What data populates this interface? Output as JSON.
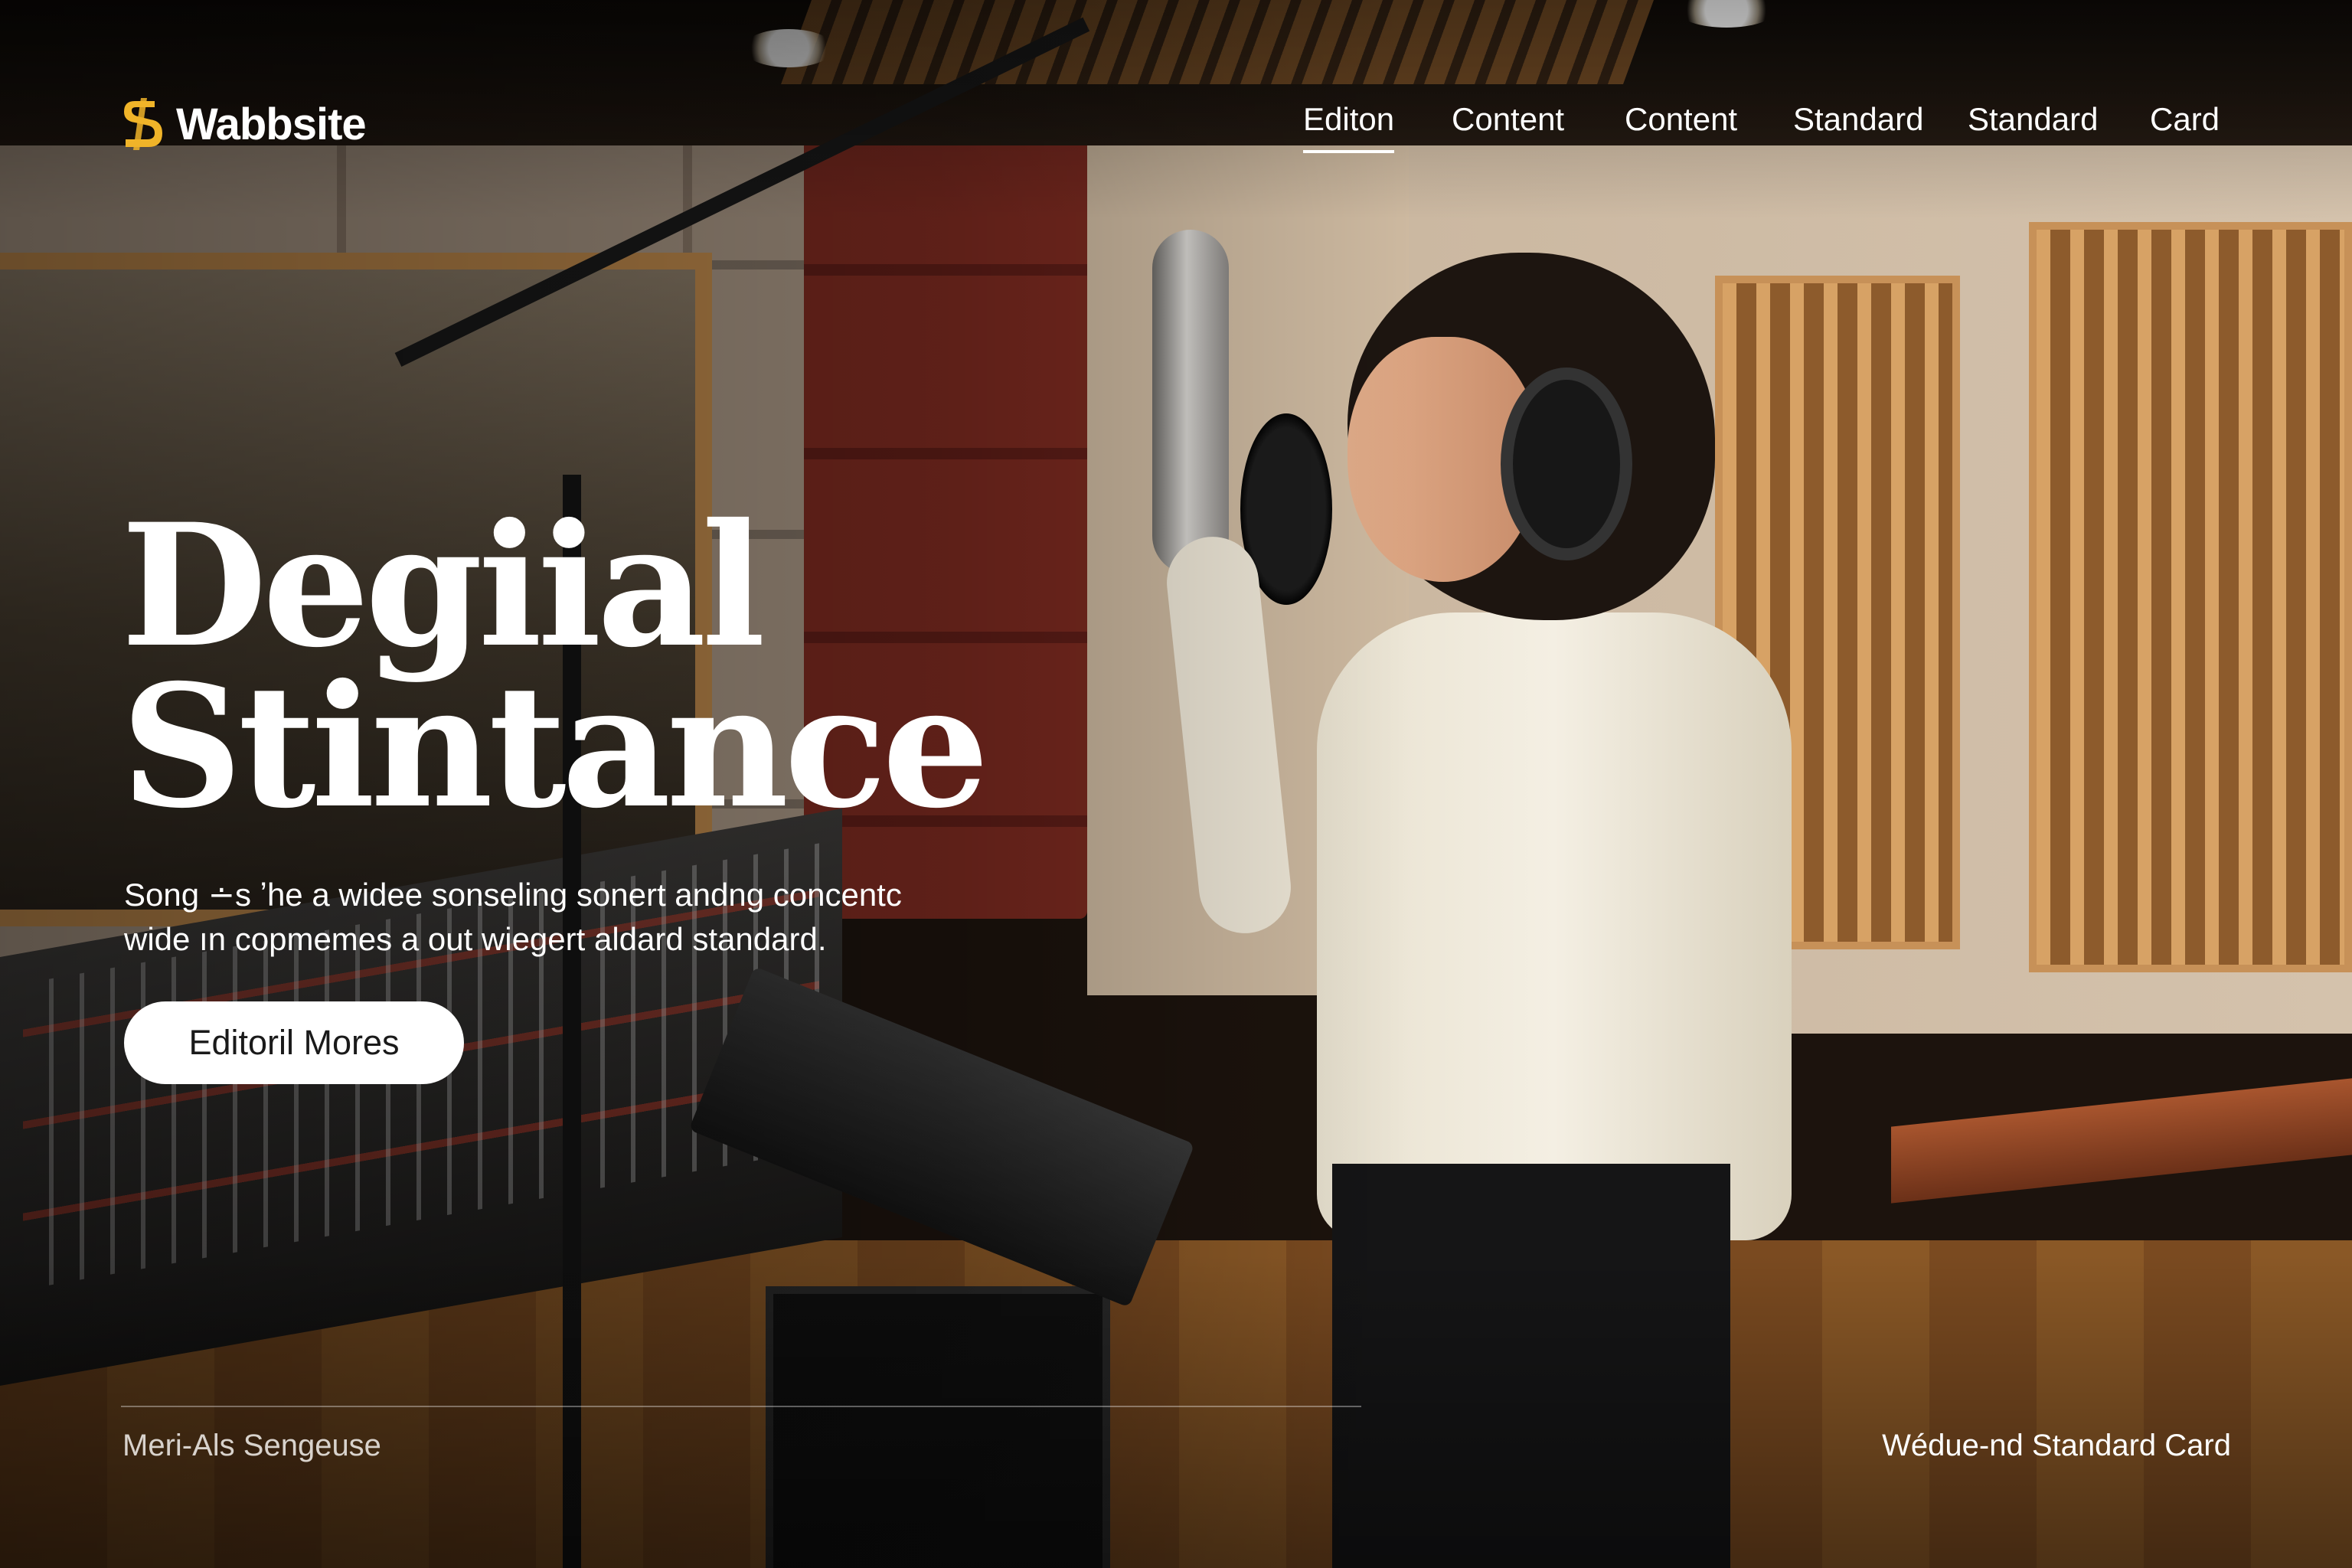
{
  "brand": {
    "name": "Wabbsite",
    "icon": "s-logo-icon",
    "accent_color": "#f0b429"
  },
  "nav": {
    "items": [
      {
        "label": "Editon",
        "active": true
      },
      {
        "label": "Content",
        "active": false
      },
      {
        "label": "Content",
        "active": false
      },
      {
        "label": "Standard",
        "active": false
      },
      {
        "label": "Standard",
        "active": false
      },
      {
        "label": "Card",
        "active": false
      }
    ]
  },
  "hero": {
    "title_line1": "Degiial",
    "title_line2": "Stintance",
    "subtitle_line1": "Song ∸s ʼhe a widee sonseling sonert andng concentc",
    "subtitle_line2": "wide ın copmemes a out wiegert aldard standard.",
    "cta_label": "Editoril Mores"
  },
  "footer": {
    "left_text": "Meri-Als Sengeuse",
    "right_text": "Wédue-nd Standard Card"
  }
}
